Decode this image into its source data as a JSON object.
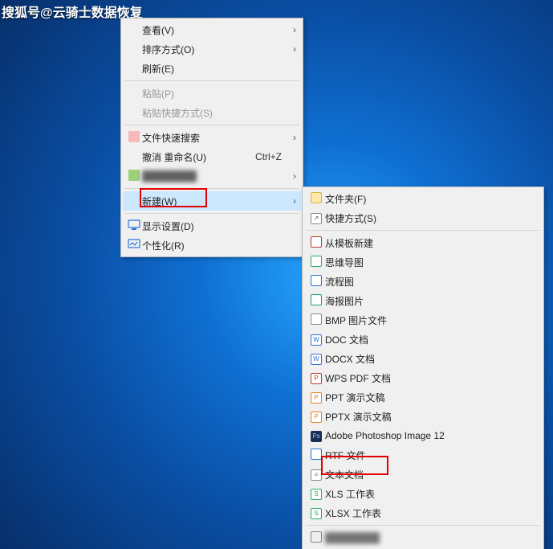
{
  "watermark": {
    "prefix": "搜狐号",
    "at": "@",
    "name": "云骑士数据恢复"
  },
  "menu1": {
    "view": {
      "label": "查看(V)"
    },
    "sort": {
      "label": "排序方式(O)"
    },
    "refresh": {
      "label": "刷新(E)"
    },
    "paste": {
      "label": "粘贴(P)"
    },
    "pasteShortcut": {
      "label": "粘贴快捷方式(S)"
    },
    "quickSearch": {
      "label": "文件快速搜索"
    },
    "undoRename": {
      "label": "撤消 重命名(U)",
      "hint": "Ctrl+Z"
    },
    "blurred": {
      "label": "████████"
    },
    "new": {
      "label": "新建(W)"
    },
    "display": {
      "label": "显示设置(D)"
    },
    "personalize": {
      "label": "个性化(R)"
    }
  },
  "menu2": {
    "folder": {
      "label": "文件夹(F)"
    },
    "shortcut": {
      "label": "快捷方式(S)"
    },
    "fromTemplate": {
      "label": "从模板新建"
    },
    "mindmap": {
      "label": "思维导图"
    },
    "flowchart": {
      "label": "流程图"
    },
    "poster": {
      "label": "海报图片"
    },
    "bmp": {
      "label": "BMP 图片文件"
    },
    "doc": {
      "label": "DOC 文档"
    },
    "docx": {
      "label": "DOCX 文档"
    },
    "wpspdf": {
      "label": "WPS PDF 文档"
    },
    "ppt": {
      "label": "PPT 演示文稿"
    },
    "pptx": {
      "label": "PPTX 演示文稿"
    },
    "psd": {
      "label": "Adobe Photoshop Image 12"
    },
    "rtf": {
      "label": "RTF 文件"
    },
    "txt": {
      "label": "文本文档"
    },
    "xls": {
      "label": "XLS 工作表"
    },
    "xlsx": {
      "label": "XLSX 工作表"
    },
    "blurredLast": {
      "label": "████████"
    }
  }
}
